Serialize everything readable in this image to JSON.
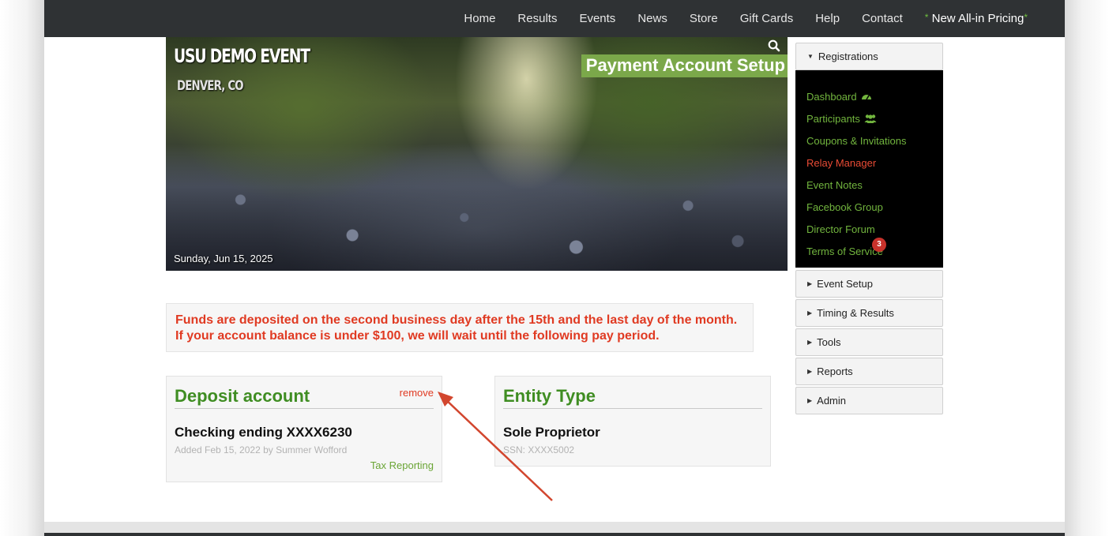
{
  "nav": {
    "items": [
      "Home",
      "Results",
      "Events",
      "News",
      "Store",
      "Gift Cards",
      "Help",
      "Contact"
    ],
    "promo_star": "*",
    "promo_label": "New All-in Pricing"
  },
  "hero": {
    "event_name": "USU DEMO EVENT",
    "location": "DENVER, CO",
    "date": "Sunday, Jun 15, 2025",
    "page_heading": "Payment Account Setup",
    "search_icon": "search-icon"
  },
  "notice": {
    "line1": "Funds are deposited on the second business day after the 15th and the last day of the month.",
    "line2": "If your account balance is under $100, we will wait until the following pay period."
  },
  "deposit": {
    "title": "Deposit account",
    "remove_label": "remove",
    "account": "Checking ending XXXX6230",
    "added": "Added Feb 15, 2022 by Summer Wofford",
    "tax_link": "Tax Reporting"
  },
  "entity": {
    "title": "Entity Type",
    "type": "Sole Proprietor",
    "ssn": "SSN: XXXX5002"
  },
  "sidebar": {
    "registrations_label": "Registrations",
    "items": [
      {
        "label": "Dashboard",
        "icon": "dashboard-icon"
      },
      {
        "label": "Participants",
        "icon": "users-icon"
      },
      {
        "label": "Coupons & Invitations"
      },
      {
        "label": "Relay Manager"
      },
      {
        "label": "Event Notes"
      },
      {
        "label": "Facebook Group"
      },
      {
        "label": "Director Forum",
        "badge": "3"
      },
      {
        "label": "Terms of Service"
      }
    ],
    "sections": [
      "Event Setup",
      "Timing & Results",
      "Tools",
      "Reports",
      "Admin"
    ]
  },
  "colors": {
    "nav_bg": "#2f3234",
    "accent_green": "#3f8d22",
    "link_green": "#72b53e",
    "alert_red": "#e03a22",
    "heading_bg": "#7ba84a"
  }
}
